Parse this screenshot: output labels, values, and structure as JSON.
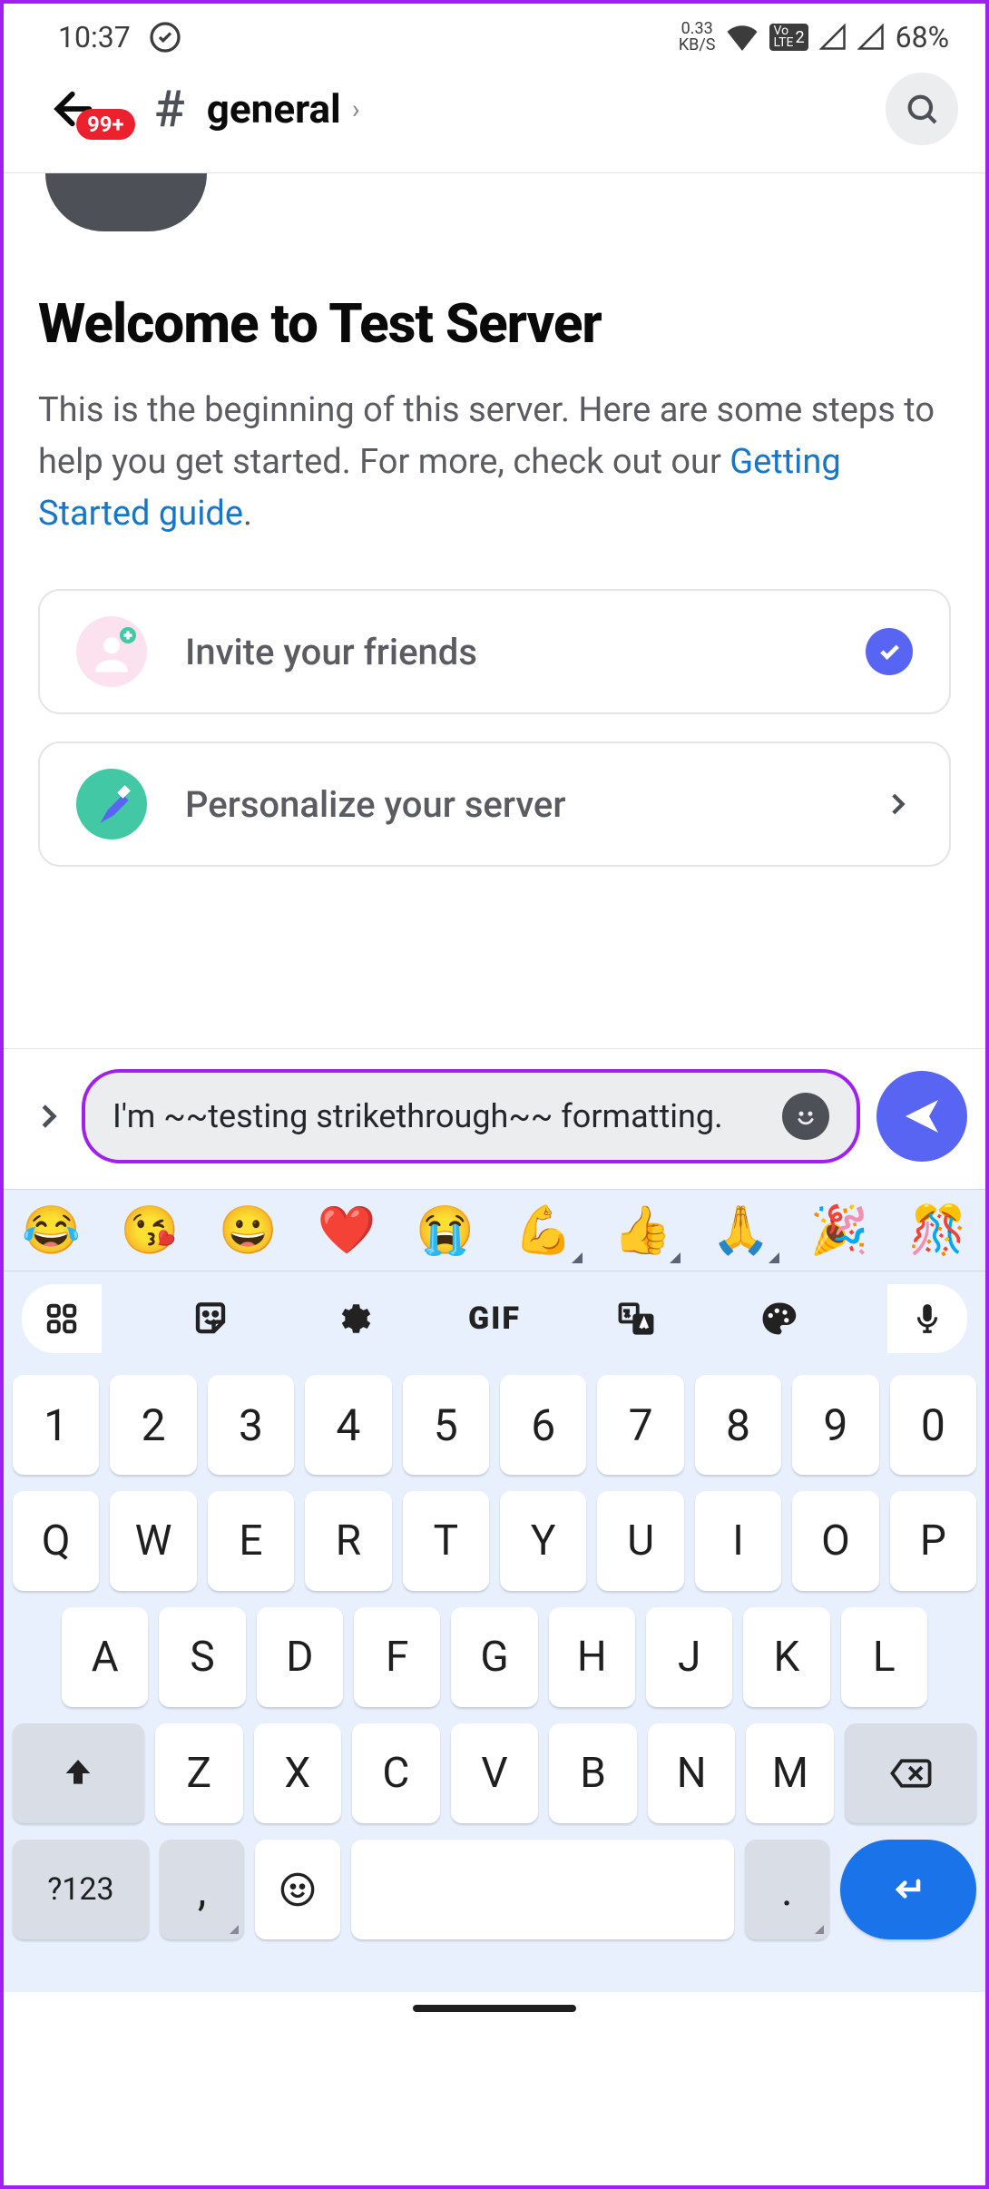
{
  "status": {
    "time": "10:37",
    "kbs_top": "0.33",
    "kbs_bot": "KB/S",
    "lte": "Vo\nLTE",
    "sim": "2",
    "battery": "68%"
  },
  "header": {
    "badge": "99+",
    "channel": "general"
  },
  "welcome": {
    "title": "Welcome to Test Server",
    "subtitle_pre": "This is the beginning of this server. Here are some steps to help you get started. For more, check out our ",
    "link": "Getting Started guide",
    "subtitle_post": "."
  },
  "cards": [
    {
      "label": "Invite your friends",
      "done": true
    },
    {
      "label": "Personalize your server",
      "done": false
    }
  ],
  "input": {
    "text": "I'm ~~testing strikethrough~~ formatting."
  },
  "emojis": [
    "😂",
    "😘",
    "😀",
    "❤️",
    "😭",
    "💪",
    "👍",
    "🙏",
    "🎉",
    "🎊"
  ],
  "tools": {
    "gif": "GIF"
  },
  "keyboard": {
    "row1": [
      "1",
      "2",
      "3",
      "4",
      "5",
      "6",
      "7",
      "8",
      "9",
      "0"
    ],
    "row2": [
      "Q",
      "W",
      "E",
      "R",
      "T",
      "Y",
      "U",
      "I",
      "O",
      "P"
    ],
    "row3": [
      "A",
      "S",
      "D",
      "F",
      "G",
      "H",
      "J",
      "K",
      "L"
    ],
    "row4": [
      "Z",
      "X",
      "C",
      "V",
      "B",
      "N",
      "M"
    ],
    "sym": "?123",
    "comma": ",",
    "period": "."
  }
}
